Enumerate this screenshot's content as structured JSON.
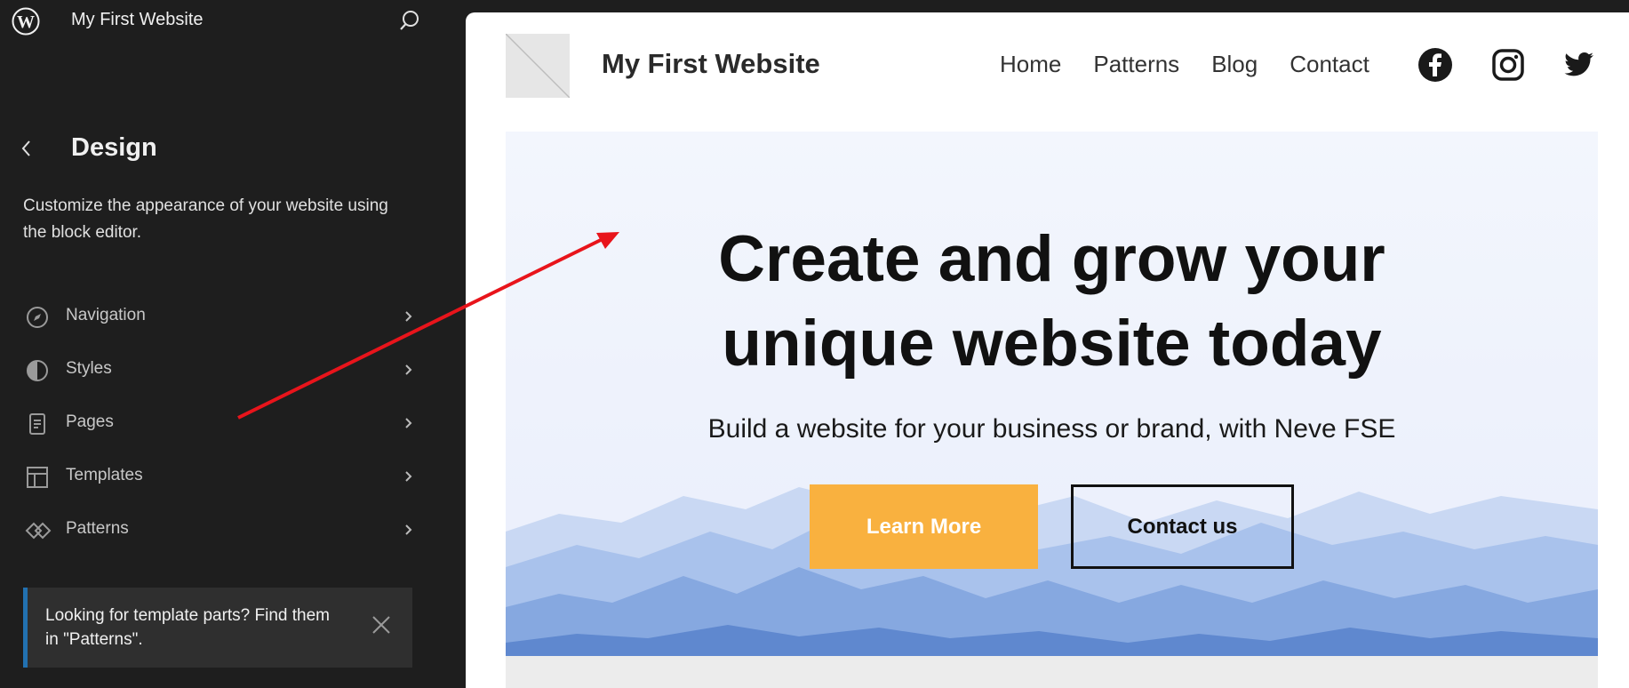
{
  "sidebar": {
    "site_name": "My First Website",
    "section_title": "Design",
    "description": "Customize the appearance of your website using the block editor.",
    "menu": [
      {
        "label": "Navigation",
        "icon": "compass-icon"
      },
      {
        "label": "Styles",
        "icon": "half-circle-icon"
      },
      {
        "label": "Pages",
        "icon": "page-icon"
      },
      {
        "label": "Templates",
        "icon": "layout-icon"
      },
      {
        "label": "Patterns",
        "icon": "diamond-icon"
      }
    ],
    "notice": {
      "text": "Looking for template parts? Find them in \"Patterns\"."
    }
  },
  "preview": {
    "site_title": "My First Website",
    "nav": [
      "Home",
      "Patterns",
      "Blog",
      "Contact"
    ],
    "social": [
      "facebook-icon",
      "instagram-icon",
      "twitter-icon"
    ],
    "hero": {
      "title_line1": "Create and grow your",
      "title_line2": "unique website today",
      "subtitle": "Build a website for your business or brand, with Neve FSE",
      "primary_button": "Learn More",
      "secondary_button": "Contact us"
    }
  },
  "colors": {
    "sidebar_bg": "#1e1e1e",
    "accent_button": "#f9b13f",
    "notice_border": "#2271b1",
    "arrow": "#e8141b"
  }
}
